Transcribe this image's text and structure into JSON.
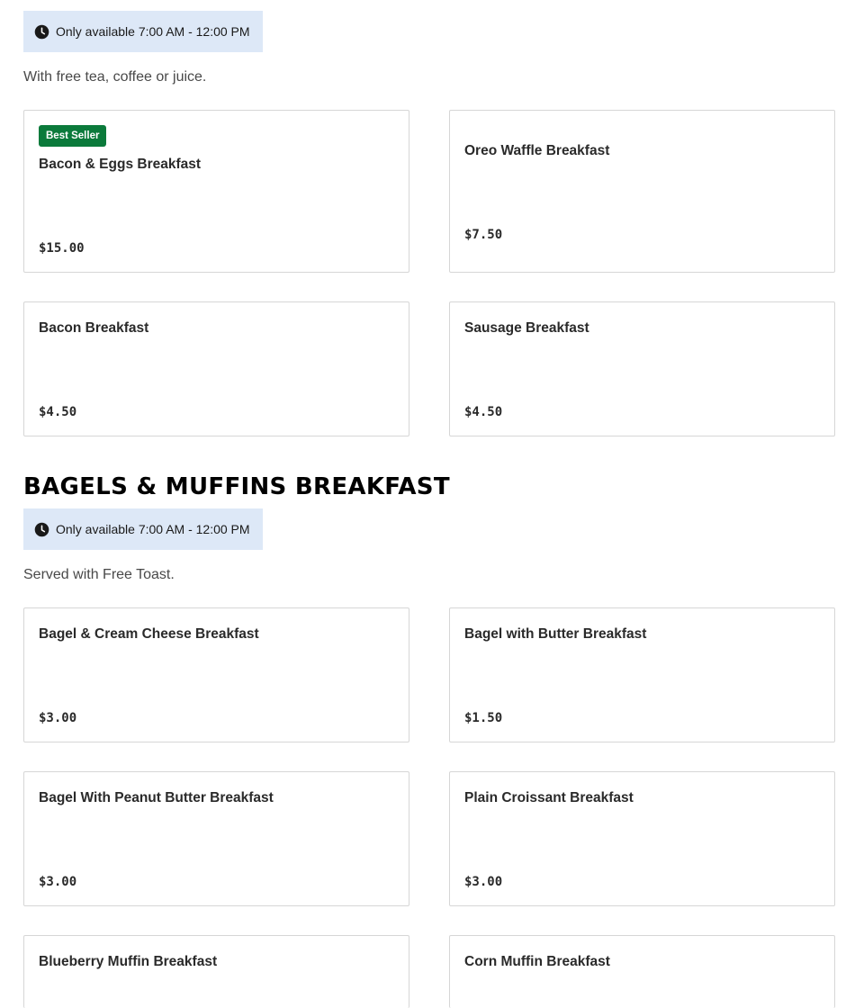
{
  "colors": {
    "availability_bg": "#dde8f7",
    "badge_bg": "#0b7a3b",
    "card_border": "#d6d6d6"
  },
  "section1": {
    "availability": "Only available 7:00 AM - 12:00 PM",
    "description": "With free tea, coffee or juice.",
    "items": [
      {
        "badge": "Best Seller",
        "name": "Bacon & Eggs Breakfast",
        "price": "$15.00"
      },
      {
        "name": "Oreo Waffle Breakfast",
        "price": "$7.50"
      },
      {
        "name": "Bacon Breakfast",
        "price": "$4.50"
      },
      {
        "name": "Sausage Breakfast",
        "price": "$4.50"
      }
    ]
  },
  "section2": {
    "title": "BAGELS & MUFFINS BREAKFAST",
    "availability": "Only available 7:00 AM - 12:00 PM",
    "description": "Served with Free Toast.",
    "items": [
      {
        "name": "Bagel & Cream Cheese Breakfast",
        "price": "$3.00"
      },
      {
        "name": "Bagel with Butter Breakfast",
        "price": "$1.50"
      },
      {
        "name": "Bagel With Peanut Butter Breakfast",
        "price": "$3.00"
      },
      {
        "name": "Plain Croissant Breakfast",
        "price": "$3.00"
      },
      {
        "name": "Blueberry Muffin Breakfast"
      },
      {
        "name": "Corn Muffin Breakfast"
      }
    ]
  }
}
